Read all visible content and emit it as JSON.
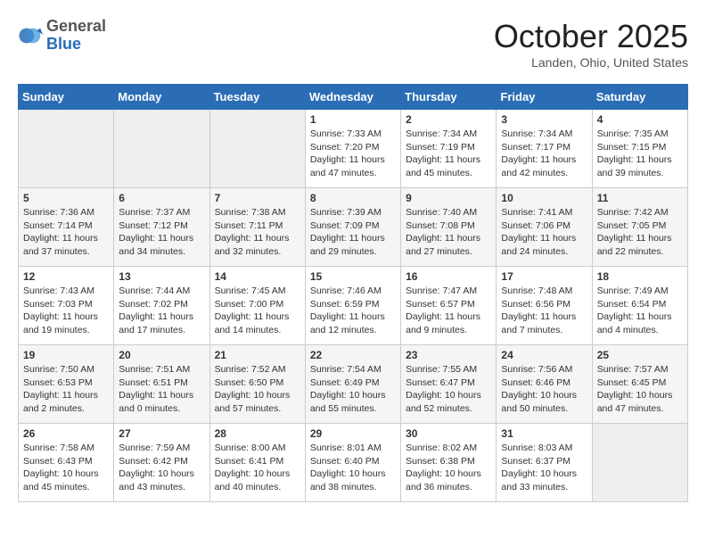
{
  "header": {
    "logo_general": "General",
    "logo_blue": "Blue",
    "month_title": "October 2025",
    "location": "Landen, Ohio, United States"
  },
  "days_of_week": [
    "Sunday",
    "Monday",
    "Tuesday",
    "Wednesday",
    "Thursday",
    "Friday",
    "Saturday"
  ],
  "weeks": [
    [
      {
        "day": "",
        "info": ""
      },
      {
        "day": "",
        "info": ""
      },
      {
        "day": "",
        "info": ""
      },
      {
        "day": "1",
        "info": "Sunrise: 7:33 AM\nSunset: 7:20 PM\nDaylight: 11 hours and 47 minutes."
      },
      {
        "day": "2",
        "info": "Sunrise: 7:34 AM\nSunset: 7:19 PM\nDaylight: 11 hours and 45 minutes."
      },
      {
        "day": "3",
        "info": "Sunrise: 7:34 AM\nSunset: 7:17 PM\nDaylight: 11 hours and 42 minutes."
      },
      {
        "day": "4",
        "info": "Sunrise: 7:35 AM\nSunset: 7:15 PM\nDaylight: 11 hours and 39 minutes."
      }
    ],
    [
      {
        "day": "5",
        "info": "Sunrise: 7:36 AM\nSunset: 7:14 PM\nDaylight: 11 hours and 37 minutes."
      },
      {
        "day": "6",
        "info": "Sunrise: 7:37 AM\nSunset: 7:12 PM\nDaylight: 11 hours and 34 minutes."
      },
      {
        "day": "7",
        "info": "Sunrise: 7:38 AM\nSunset: 7:11 PM\nDaylight: 11 hours and 32 minutes."
      },
      {
        "day": "8",
        "info": "Sunrise: 7:39 AM\nSunset: 7:09 PM\nDaylight: 11 hours and 29 minutes."
      },
      {
        "day": "9",
        "info": "Sunrise: 7:40 AM\nSunset: 7:08 PM\nDaylight: 11 hours and 27 minutes."
      },
      {
        "day": "10",
        "info": "Sunrise: 7:41 AM\nSunset: 7:06 PM\nDaylight: 11 hours and 24 minutes."
      },
      {
        "day": "11",
        "info": "Sunrise: 7:42 AM\nSunset: 7:05 PM\nDaylight: 11 hours and 22 minutes."
      }
    ],
    [
      {
        "day": "12",
        "info": "Sunrise: 7:43 AM\nSunset: 7:03 PM\nDaylight: 11 hours and 19 minutes."
      },
      {
        "day": "13",
        "info": "Sunrise: 7:44 AM\nSunset: 7:02 PM\nDaylight: 11 hours and 17 minutes."
      },
      {
        "day": "14",
        "info": "Sunrise: 7:45 AM\nSunset: 7:00 PM\nDaylight: 11 hours and 14 minutes."
      },
      {
        "day": "15",
        "info": "Sunrise: 7:46 AM\nSunset: 6:59 PM\nDaylight: 11 hours and 12 minutes."
      },
      {
        "day": "16",
        "info": "Sunrise: 7:47 AM\nSunset: 6:57 PM\nDaylight: 11 hours and 9 minutes."
      },
      {
        "day": "17",
        "info": "Sunrise: 7:48 AM\nSunset: 6:56 PM\nDaylight: 11 hours and 7 minutes."
      },
      {
        "day": "18",
        "info": "Sunrise: 7:49 AM\nSunset: 6:54 PM\nDaylight: 11 hours and 4 minutes."
      }
    ],
    [
      {
        "day": "19",
        "info": "Sunrise: 7:50 AM\nSunset: 6:53 PM\nDaylight: 11 hours and 2 minutes."
      },
      {
        "day": "20",
        "info": "Sunrise: 7:51 AM\nSunset: 6:51 PM\nDaylight: 11 hours and 0 minutes."
      },
      {
        "day": "21",
        "info": "Sunrise: 7:52 AM\nSunset: 6:50 PM\nDaylight: 10 hours and 57 minutes."
      },
      {
        "day": "22",
        "info": "Sunrise: 7:54 AM\nSunset: 6:49 PM\nDaylight: 10 hours and 55 minutes."
      },
      {
        "day": "23",
        "info": "Sunrise: 7:55 AM\nSunset: 6:47 PM\nDaylight: 10 hours and 52 minutes."
      },
      {
        "day": "24",
        "info": "Sunrise: 7:56 AM\nSunset: 6:46 PM\nDaylight: 10 hours and 50 minutes."
      },
      {
        "day": "25",
        "info": "Sunrise: 7:57 AM\nSunset: 6:45 PM\nDaylight: 10 hours and 47 minutes."
      }
    ],
    [
      {
        "day": "26",
        "info": "Sunrise: 7:58 AM\nSunset: 6:43 PM\nDaylight: 10 hours and 45 minutes."
      },
      {
        "day": "27",
        "info": "Sunrise: 7:59 AM\nSunset: 6:42 PM\nDaylight: 10 hours and 43 minutes."
      },
      {
        "day": "28",
        "info": "Sunrise: 8:00 AM\nSunset: 6:41 PM\nDaylight: 10 hours and 40 minutes."
      },
      {
        "day": "29",
        "info": "Sunrise: 8:01 AM\nSunset: 6:40 PM\nDaylight: 10 hours and 38 minutes."
      },
      {
        "day": "30",
        "info": "Sunrise: 8:02 AM\nSunset: 6:38 PM\nDaylight: 10 hours and 36 minutes."
      },
      {
        "day": "31",
        "info": "Sunrise: 8:03 AM\nSunset: 6:37 PM\nDaylight: 10 hours and 33 minutes."
      },
      {
        "day": "",
        "info": ""
      }
    ]
  ]
}
